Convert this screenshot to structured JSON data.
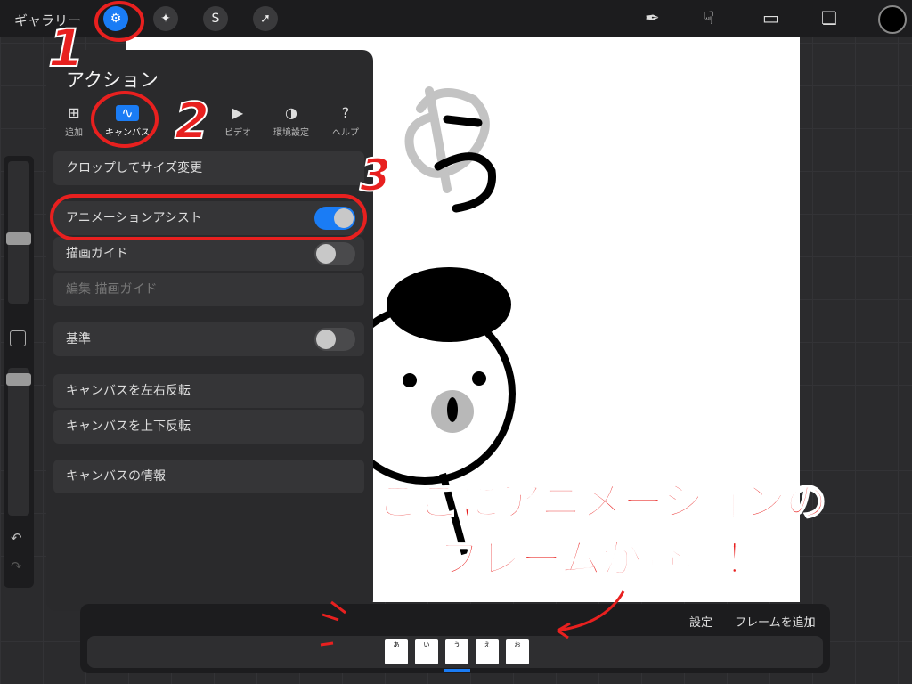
{
  "toolbar": {
    "gallery_label": "ギャラリー",
    "left_icons": [
      "wrench-icon",
      "magic-wand-icon",
      "selection-icon",
      "transform-arrow-icon"
    ],
    "right_icons": [
      "brush-icon",
      "smudge-icon",
      "eraser-icon",
      "layers-icon"
    ],
    "color": "#000000"
  },
  "panel": {
    "title": "アクション",
    "tabs": [
      {
        "label": "追加",
        "icon": "add-icon",
        "active": false
      },
      {
        "label": "キャンバス",
        "icon": "canvas-icon",
        "active": true
      },
      {
        "label": "ビデオ",
        "icon": "play-icon",
        "active": false
      },
      {
        "label": "環境設定",
        "icon": "toggle-icon",
        "active": false
      },
      {
        "label": "ヘルプ",
        "icon": "help-icon",
        "active": false
      }
    ],
    "rows": {
      "crop": "クロップしてサイズ変更",
      "animation_assist": "アニメーションアシスト",
      "drawing_guide": "描画ガイド",
      "edit_drawing_guide": "編集 描画ガイド",
      "reference": "基準",
      "flip_h": "キャンバスを左右反転",
      "flip_v": "キャンバスを上下反転",
      "canvas_info": "キャンバスの情報"
    },
    "toggles": {
      "animation_assist": true,
      "drawing_guide": false,
      "reference": false
    }
  },
  "timeline": {
    "settings_label": "設定",
    "add_frame_label": "フレームを追加",
    "frames": [
      "あ",
      "い",
      "う",
      "え",
      "お"
    ]
  },
  "annotations": {
    "step1": "1",
    "step2": "2",
    "step3": "3",
    "callout_line1": "ここにアニメーションの",
    "callout_line2": "フレームが登場！",
    "accent_color": "#e8201f"
  }
}
